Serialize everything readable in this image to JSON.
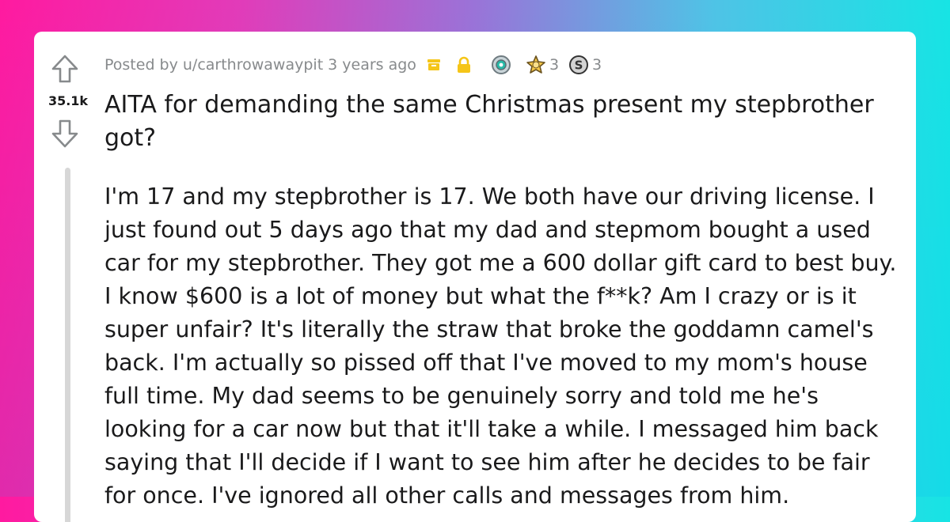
{
  "post": {
    "votes": "35.1k",
    "meta": {
      "posted_by": "Posted by u/carthrowawaypit",
      "time_ago": "3 years ago",
      "award_count_1": "3",
      "award_count_2": "3"
    },
    "title": "AITA for demanding the same Christmas present my stepbrother got?",
    "body": "I'm 17 and my stepbrother is 17. We both have our driving license. I just found out 5 days ago that my dad and stepmom bought a used car for my stepbrother. They got me a 600 dollar gift card to best buy. I know $600 is a lot of money but what the f**k? Am I crazy or is it super unfair? It's literally the straw that broke the goddamn camel's back. I'm actually so pissed off that I've moved to my mom's house full time. My dad seems to be genuinely sorry and told me he's looking for a car now but that it'll take a while. I messaged him back saying that I'll decide if I want to see him after he decides to be fair for once. I've ignored all other calls and messages from him."
  },
  "icons": {
    "upvote": "upvote-arrow-icon",
    "downvote": "downvote-arrow-icon",
    "archived": "archive-box-icon",
    "locked": "lock-icon",
    "award_1": "helpful-award-icon",
    "award_2": "wholesome-award-icon",
    "award_3": "silver-award-icon"
  },
  "colors": {
    "archive": "#f5c518",
    "lock": "#f5c518",
    "text": "#1a1a1b",
    "meta": "#878a8c"
  }
}
